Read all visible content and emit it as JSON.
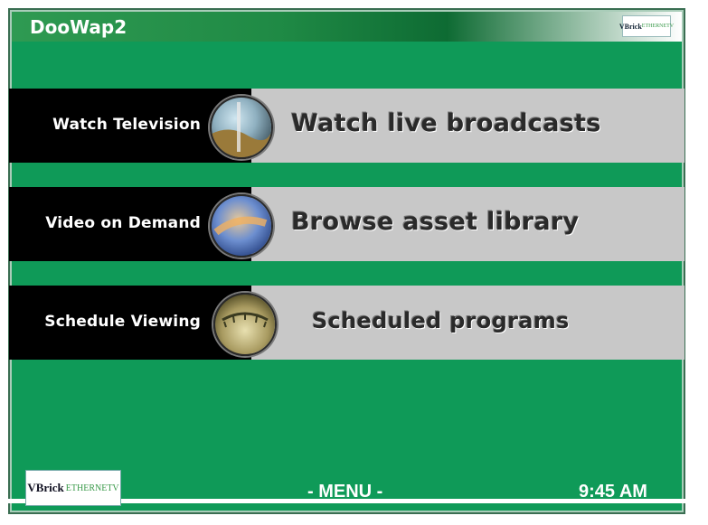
{
  "window": {
    "title": "DooWap2",
    "brand_logo": "VBrick EtherneTV"
  },
  "colors": {
    "background_green": "#0f9a58",
    "row_left": "#000000",
    "row_right": "#c8c8c8"
  },
  "menu_items": [
    {
      "label": "Watch Television",
      "description": "Watch live broadcasts",
      "icon": "globe-tv-icon"
    },
    {
      "label": "Video on Demand",
      "description": "Browse asset library",
      "icon": "globe-vod-icon"
    },
    {
      "label": "Schedule Viewing",
      "description": "Scheduled programs",
      "icon": "globe-schedule-icon"
    }
  ],
  "footer": {
    "logo": "VBrick EtherneTV",
    "menu_label": "- MENU -",
    "time": "9:45 AM"
  }
}
